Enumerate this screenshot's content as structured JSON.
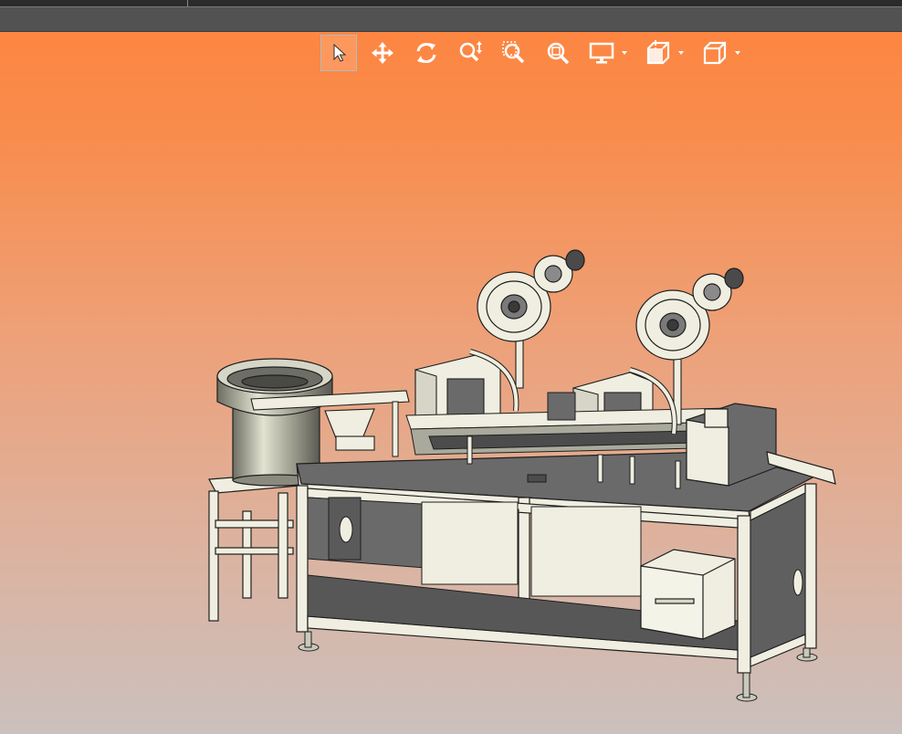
{
  "viewer": {
    "background_top": "#ff843f",
    "background_bottom": "#cbc0bd",
    "titlebar_color": "#525252"
  },
  "toolbar": {
    "tools": [
      {
        "name": "select-tool",
        "icon": "cursor-arrow-icon",
        "active": true
      },
      {
        "name": "pan-tool",
        "icon": "move-arrows-icon",
        "active": false
      },
      {
        "name": "rotate-tool",
        "icon": "rotate-icon",
        "active": false
      },
      {
        "name": "zoom-dynamic-tool",
        "icon": "zoom-updown-icon",
        "active": false
      },
      {
        "name": "zoom-window-tool",
        "icon": "zoom-window-icon",
        "active": false
      },
      {
        "name": "zoom-fit-tool",
        "icon": "zoom-fit-icon",
        "active": false
      },
      {
        "name": "display-mode-menu",
        "icon": "monitor-icon",
        "active": false,
        "dropdown": true
      },
      {
        "name": "section-view-menu",
        "icon": "section-cube-icon",
        "active": false,
        "dropdown": true
      },
      {
        "name": "view-orientation-menu",
        "icon": "cube-icon",
        "active": false,
        "dropdown": true
      }
    ]
  },
  "model": {
    "description_icon": "assembly-machine-3d-model",
    "colors": {
      "frame": "#efeee0",
      "plate": "#6a6a6a",
      "edge": "#1e1e1e",
      "bowl": "#9c9c90"
    }
  }
}
